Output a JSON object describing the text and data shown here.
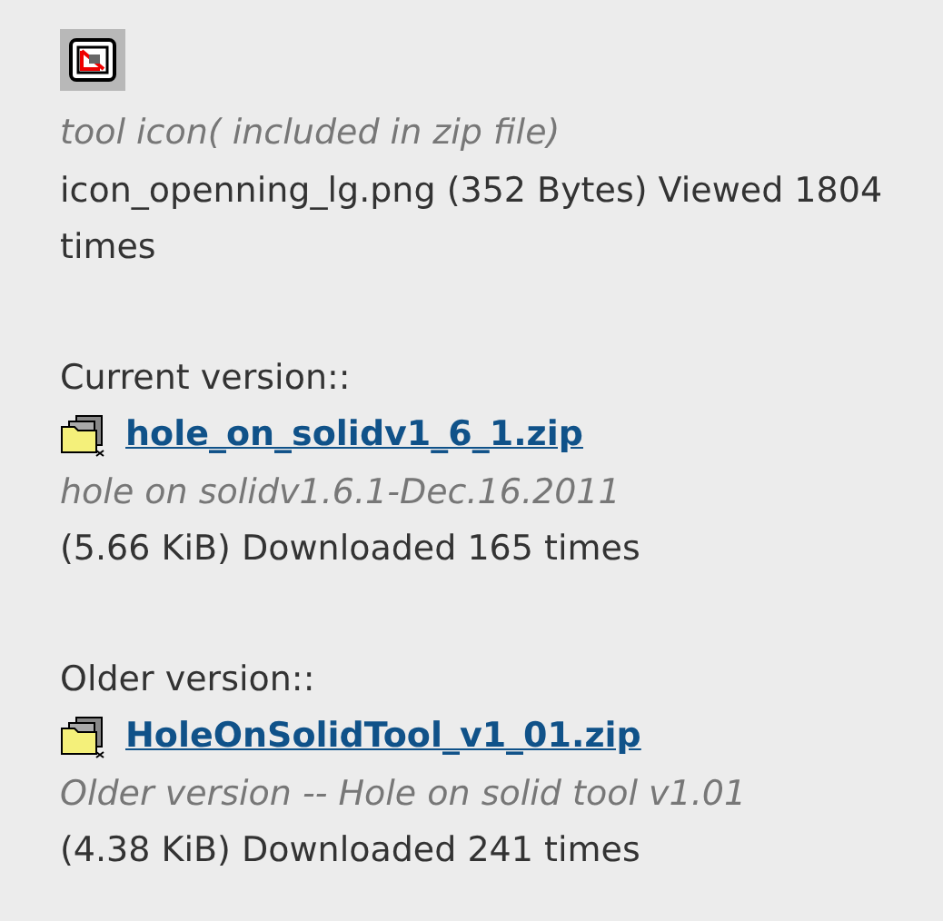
{
  "tool_icon": {
    "caption": "tool icon( included in zip file)",
    "file_info": "icon_openning_lg.png (352 Bytes) Viewed 1804 times"
  },
  "sections": [
    {
      "heading": "Current version::",
      "file_link": "hole_on_solidv1_6_1.zip",
      "description": "hole on solidv1.6.1-Dec.16.2011",
      "stats": "(5.66 KiB) Downloaded 165 times"
    },
    {
      "heading": "Older version::",
      "file_link": "HoleOnSolidTool_v1_01.zip",
      "description": "Older version -- Hole on solid tool v1.01",
      "stats": "(4.38 KiB) Downloaded 241 times"
    }
  ]
}
